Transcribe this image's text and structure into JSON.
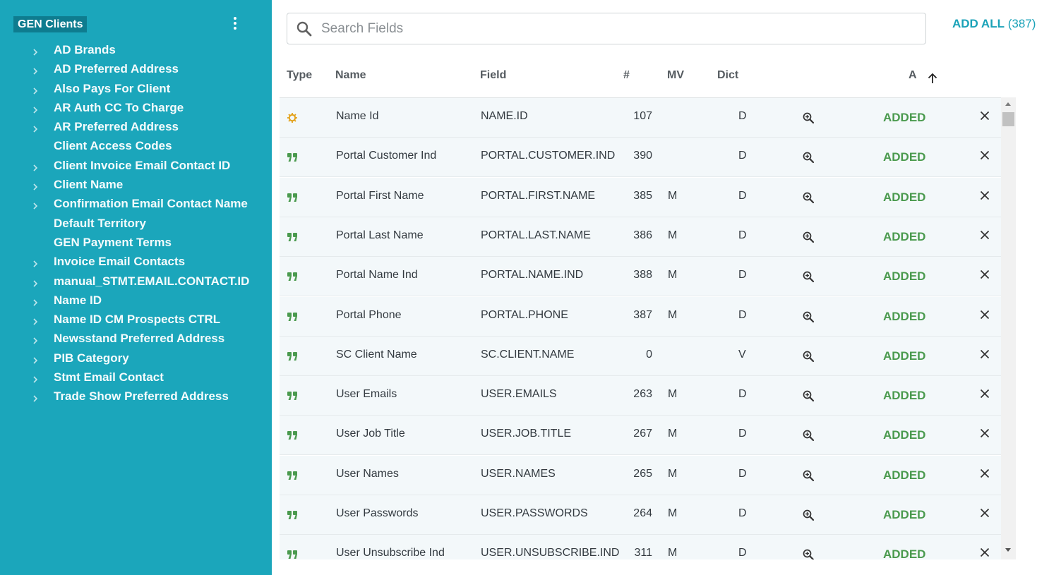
{
  "sidebar": {
    "title": "GEN Clients",
    "items": [
      {
        "label": "AD Brands",
        "expandable": true
      },
      {
        "label": "AD Preferred Address",
        "expandable": true
      },
      {
        "label": "Also Pays For Client",
        "expandable": true
      },
      {
        "label": "AR Auth CC To Charge",
        "expandable": true
      },
      {
        "label": "AR Preferred Address",
        "expandable": true
      },
      {
        "label": "Client Access Codes",
        "expandable": false
      },
      {
        "label": "Client Invoice Email Contact ID",
        "expandable": true
      },
      {
        "label": "Client Name",
        "expandable": true
      },
      {
        "label": "Confirmation Email Contact Name",
        "expandable": true
      },
      {
        "label": "Default Territory",
        "expandable": false
      },
      {
        "label": "GEN Payment Terms",
        "expandable": false
      },
      {
        "label": "Invoice Email Contacts",
        "expandable": true
      },
      {
        "label": "manual_STMT.EMAIL.CONTACT.ID",
        "expandable": true
      },
      {
        "label": "Name ID",
        "expandable": true
      },
      {
        "label": "Name ID CM Prospects CTRL",
        "expandable": true
      },
      {
        "label": "Newsstand Preferred Address",
        "expandable": true
      },
      {
        "label": "PIB Category",
        "expandable": true
      },
      {
        "label": "Stmt Email Contact",
        "expandable": true
      },
      {
        "label": "Trade Show Preferred Address",
        "expandable": true
      }
    ]
  },
  "search": {
    "placeholder": "Search Fields",
    "value": ""
  },
  "add_all": {
    "label": "ADD ALL",
    "count": "(387)"
  },
  "table": {
    "headers": {
      "type": "Type",
      "name": "Name",
      "field": "Field",
      "num": "#",
      "mv": "MV",
      "dict": "Dict",
      "added": "A"
    },
    "rows": [
      {
        "type": "key",
        "name": "Name Id",
        "field": "NAME.ID",
        "num": "107",
        "mv": "",
        "dict": "D",
        "status": "ADDED"
      },
      {
        "type": "text",
        "name": "Portal Customer Ind",
        "field": "PORTAL.CUSTOMER.IND",
        "num": "390",
        "mv": "",
        "dict": "D",
        "status": "ADDED"
      },
      {
        "type": "text",
        "name": "Portal First Name",
        "field": "PORTAL.FIRST.NAME",
        "num": "385",
        "mv": "M",
        "dict": "D",
        "status": "ADDED"
      },
      {
        "type": "text",
        "name": "Portal Last Name",
        "field": "PORTAL.LAST.NAME",
        "num": "386",
        "mv": "M",
        "dict": "D",
        "status": "ADDED"
      },
      {
        "type": "text",
        "name": "Portal Name Ind",
        "field": "PORTAL.NAME.IND",
        "num": "388",
        "mv": "M",
        "dict": "D",
        "status": "ADDED"
      },
      {
        "type": "text",
        "name": "Portal Phone",
        "field": "PORTAL.PHONE",
        "num": "387",
        "mv": "M",
        "dict": "D",
        "status": "ADDED"
      },
      {
        "type": "text",
        "name": "SC Client Name",
        "field": "SC.CLIENT.NAME",
        "num": "0",
        "mv": "",
        "dict": "V",
        "status": "ADDED"
      },
      {
        "type": "text",
        "name": "User Emails",
        "field": "USER.EMAILS",
        "num": "263",
        "mv": "M",
        "dict": "D",
        "status": "ADDED"
      },
      {
        "type": "text",
        "name": "User Job Title",
        "field": "USER.JOB.TITLE",
        "num": "267",
        "mv": "M",
        "dict": "D",
        "status": "ADDED"
      },
      {
        "type": "text",
        "name": "User Names",
        "field": "USER.NAMES",
        "num": "265",
        "mv": "M",
        "dict": "D",
        "status": "ADDED"
      },
      {
        "type": "text",
        "name": "User Passwords",
        "field": "USER.PASSWORDS",
        "num": "264",
        "mv": "M",
        "dict": "D",
        "status": "ADDED"
      },
      {
        "type": "text",
        "name": "User Unsubscribe Ind",
        "field": "USER.UNSUBSCRIBE.IND",
        "num": "311",
        "mv": "M",
        "dict": "D",
        "status": "ADDED"
      }
    ]
  },
  "colors": {
    "sidebar": "#1ba6bb",
    "title_bg": "#0e7c8f",
    "accent": "#1aa2b8",
    "added": "#4a9a4e",
    "key_icon": "#e3a21a",
    "text_icon": "#4a9a4e"
  },
  "icons": {
    "type_key": "key-icon",
    "type_text": "quote-icon",
    "zoom": "zoom-icon",
    "remove": "close-icon",
    "sort": "arrow-up-icon",
    "expand": "chevron-right-icon"
  }
}
